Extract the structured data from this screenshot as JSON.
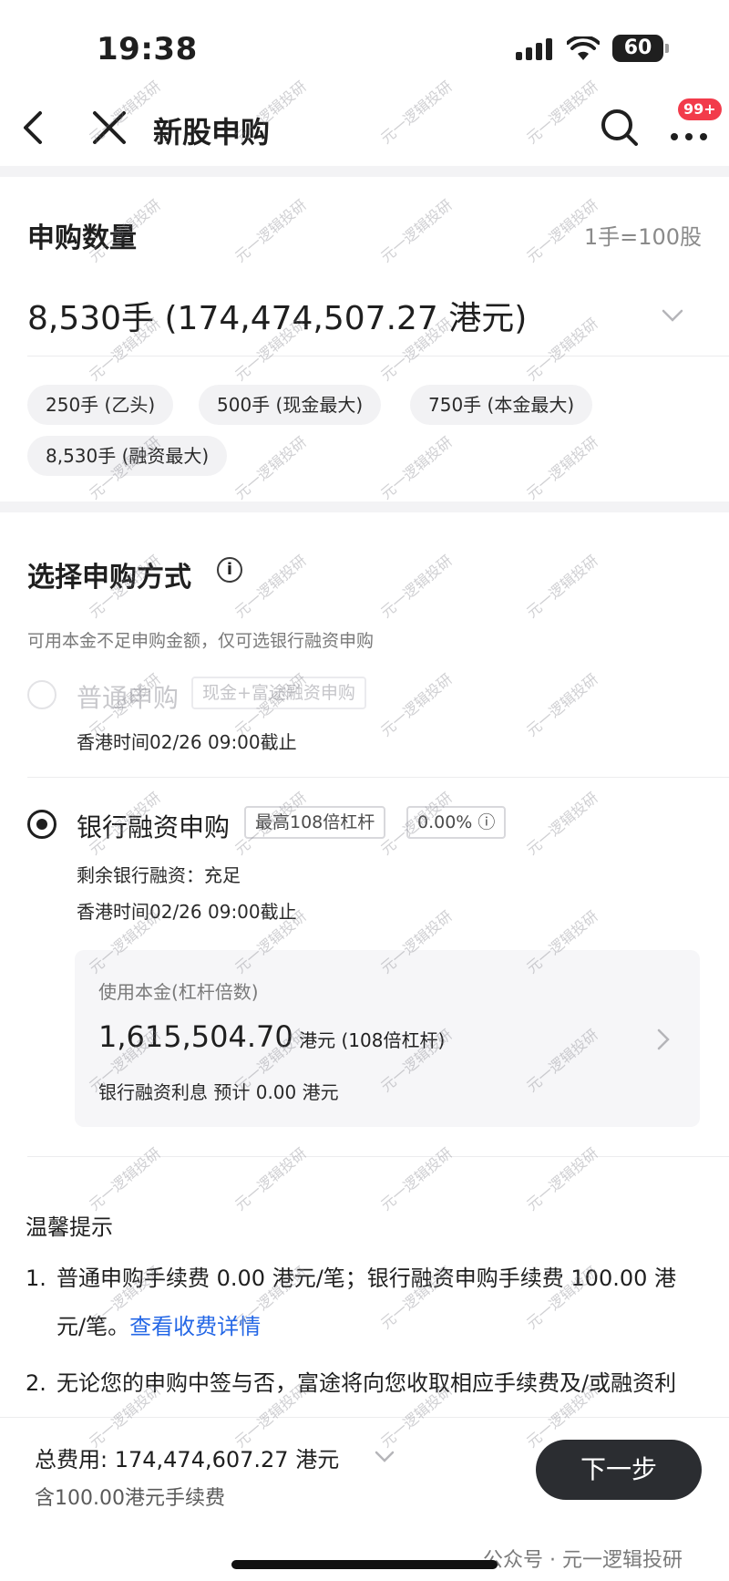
{
  "status_bar": {
    "time": "19:38",
    "battery": "60"
  },
  "nav": {
    "title": "新股申购",
    "badge": "99+"
  },
  "quantity": {
    "title": "申购数量",
    "unit_note": "1手=100股",
    "value": "8,530手 (174,474,507.27 港元)",
    "chips": [
      "250手 (乙头)",
      "500手 (现金最大)",
      "750手 (本金最大)",
      "8,530手 (融资最大)"
    ]
  },
  "method": {
    "title": "选择申购方式",
    "info_glyph": "i",
    "note": "可用本金不足申购金额，仅可选银行融资申购",
    "options": [
      {
        "title": "普通申购",
        "tag": "现金+富途融资申购",
        "deadline": "香港时间02/26 09:00截止",
        "enabled": false
      },
      {
        "title": "银行融资申购",
        "tag": "最高108倍杠杆",
        "rate_tag": "0.00% ⓘ",
        "remaining": "剩余银行融资：充足",
        "deadline": "香港时间02/26 09:00截止",
        "enabled": true
      }
    ],
    "card": {
      "label": "使用本金(杠杆倍数)",
      "amount": "1,615,504.70",
      "amount_unit": " 港元 (108倍杠杆)",
      "interest": "银行融资利息 预计 0.00 港元"
    }
  },
  "tips": {
    "title": "温馨提示",
    "items": [
      {
        "num": "1.",
        "line1": "普通申购手续费 0.00 港元/笔；银行融资申购手续费 100.00 港",
        "line2": "元/笔。",
        "link": "查看收费详情"
      },
      {
        "num": "2.",
        "line1": "无论您的申购中签与否，富途将向您收取相应手续费及/或融资利"
      }
    ]
  },
  "bottom": {
    "total": "总费用: 174,474,607.27 港元",
    "fee": "含100.00港元手续费",
    "next": "下一步",
    "footer": "公众号 · 元一逻辑投研"
  },
  "watermark": "元一逻辑投研",
  "colors": {
    "accent_link": "#2467e6",
    "badge": "#f23b4b",
    "button": "#2b2d31"
  }
}
